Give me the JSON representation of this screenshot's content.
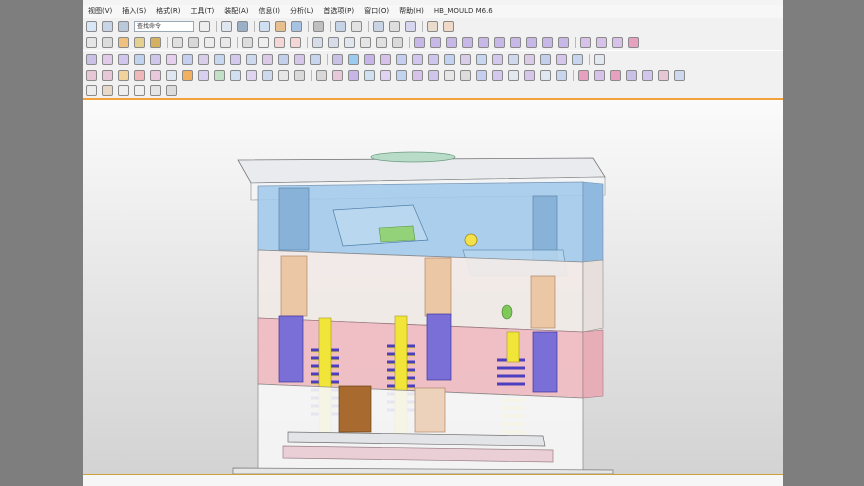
{
  "menu": {
    "items": [
      "视图(V)",
      "插入(S)",
      "格式(R)",
      "工具(T)",
      "装配(A)",
      "信息(I)",
      "分析(L)",
      "首选项(P)",
      "窗口(O)",
      "帮助(H)",
      "HB_MOULD M6.6"
    ]
  },
  "toolbar": {
    "command_finder_label": "查找命令"
  },
  "viewport": {
    "model_name": "mould-assembly",
    "colors": {
      "top_plate": "#e6e8ec",
      "cavity_plate": "#9cc7ea",
      "core_plate": "#efe6e3",
      "support_plate": "#f0bfc5",
      "ejector_pin": "#f2e53a",
      "spring": "#6b58c9",
      "guide_post": "#7a72d8",
      "bushing": "#e8c4a3",
      "cylinder": "#a5652c",
      "insert": "#8fd06a"
    }
  }
}
